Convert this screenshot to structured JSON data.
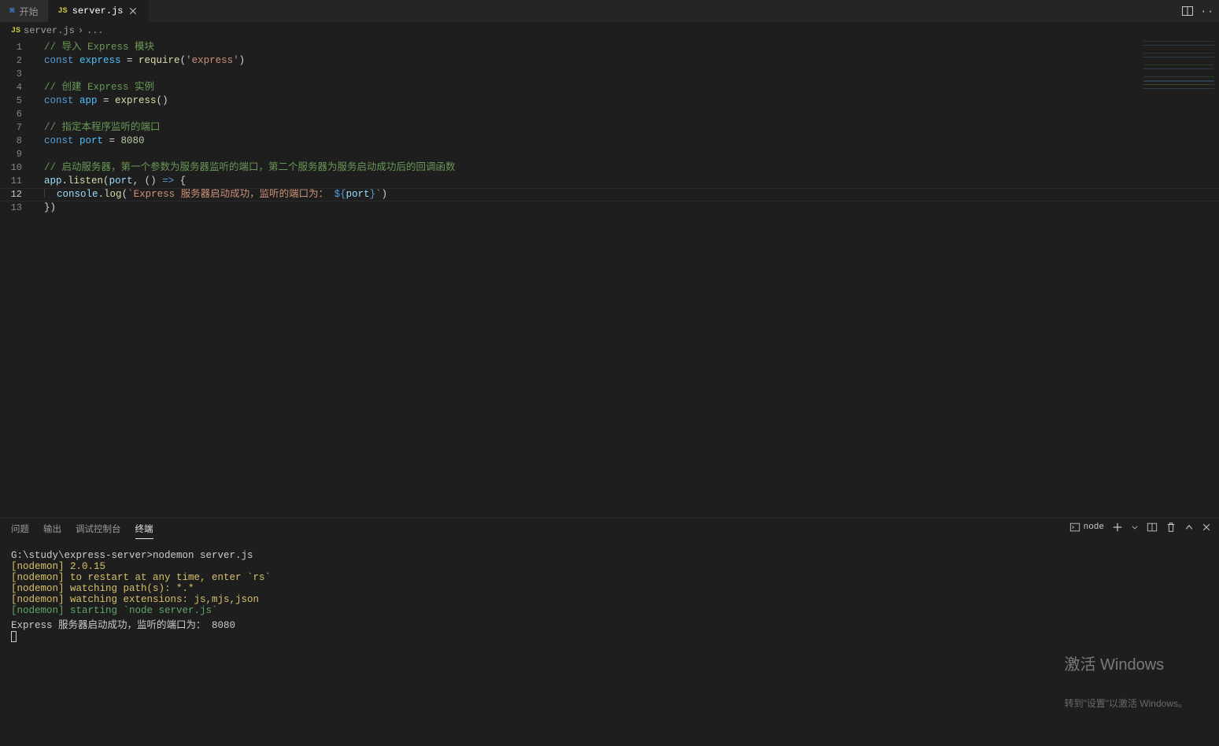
{
  "tabs": [
    {
      "label": "开始",
      "icon": "vs"
    },
    {
      "label": "server.js",
      "icon": "js",
      "active": true
    }
  ],
  "breadcrumb": {
    "icon": "js",
    "file": "server.js",
    "sep": "›",
    "rest": "..."
  },
  "code": {
    "lines": [
      {
        "n": 1,
        "tokens": [
          [
            "comment",
            "// 导入 Express 模块"
          ]
        ]
      },
      {
        "n": 2,
        "tokens": [
          [
            "keyword",
            "const "
          ],
          [
            "const",
            "express"
          ],
          [
            "op",
            " = "
          ],
          [
            "func",
            "require"
          ],
          [
            "paren",
            "("
          ],
          [
            "str",
            "'express'"
          ],
          [
            "paren",
            ")"
          ]
        ]
      },
      {
        "n": 3,
        "tokens": []
      },
      {
        "n": 4,
        "tokens": [
          [
            "comment",
            "// 创建 Express 实例"
          ]
        ]
      },
      {
        "n": 5,
        "tokens": [
          [
            "keyword",
            "const "
          ],
          [
            "const",
            "app"
          ],
          [
            "op",
            " = "
          ],
          [
            "func",
            "express"
          ],
          [
            "paren",
            "()"
          ]
        ]
      },
      {
        "n": 6,
        "tokens": []
      },
      {
        "n": 7,
        "tokens": [
          [
            "comment",
            "// 指定本程序监听的端口"
          ]
        ]
      },
      {
        "n": 8,
        "tokens": [
          [
            "keyword",
            "const "
          ],
          [
            "const",
            "port"
          ],
          [
            "op",
            " = "
          ],
          [
            "num",
            "8080"
          ]
        ]
      },
      {
        "n": 9,
        "tokens": []
      },
      {
        "n": 10,
        "tokens": [
          [
            "comment",
            "// 启动服务器，第一个参数为服务器监听的端口，第二个服务器为服务启动成功后的回调函数"
          ]
        ]
      },
      {
        "n": 11,
        "tokens": [
          [
            "var",
            "app"
          ],
          [
            "op",
            "."
          ],
          [
            "func",
            "listen"
          ],
          [
            "paren",
            "("
          ],
          [
            "var",
            "port"
          ],
          [
            "op",
            ", "
          ],
          [
            "paren",
            "()"
          ],
          [
            "op",
            " "
          ],
          [
            "keyword",
            "=>"
          ],
          [
            "op",
            " "
          ],
          [
            "paren",
            "{"
          ]
        ]
      },
      {
        "n": 12,
        "current": true,
        "indent": true,
        "tokens": [
          [
            "op",
            "  "
          ],
          [
            "var",
            "console"
          ],
          [
            "op",
            "."
          ],
          [
            "func",
            "log"
          ],
          [
            "paren",
            "("
          ],
          [
            "str",
            "`Express 服务器启动成功，监听的端口为： "
          ],
          [
            "keyword",
            "${"
          ],
          [
            "var",
            "port"
          ],
          [
            "keyword",
            "}"
          ],
          [
            "str",
            "`"
          ],
          [
            "paren",
            ")"
          ]
        ]
      },
      {
        "n": 13,
        "tokens": [
          [
            "paren",
            "})"
          ]
        ]
      }
    ]
  },
  "panel": {
    "tabs": {
      "problems": "问题",
      "output": "输出",
      "debug": "调试控制台",
      "terminal": "终端"
    },
    "activeTab": "terminal",
    "terminal": {
      "shellName": "node",
      "prompt": "G:\\study\\express-server>",
      "command": "nodemon server.js",
      "lines": [
        {
          "cls": "yellow",
          "text": "[nodemon] 2.0.15"
        },
        {
          "cls": "yellow",
          "text": "[nodemon] to restart at any time, enter `rs`"
        },
        {
          "cls": "yellow",
          "text": "[nodemon] watching path(s): *.*"
        },
        {
          "cls": "yellow",
          "text": "[nodemon] watching extensions: js,mjs,json"
        },
        {
          "cls": "green",
          "text": "[nodemon] starting `node server.js`"
        },
        {
          "cls": "white",
          "text": "Express 服务器启动成功，监听的端口为： 8080"
        }
      ]
    }
  },
  "watermark": {
    "title": "激活 Windows",
    "subtitle": "转到\"设置\"以激活 Windows。"
  }
}
